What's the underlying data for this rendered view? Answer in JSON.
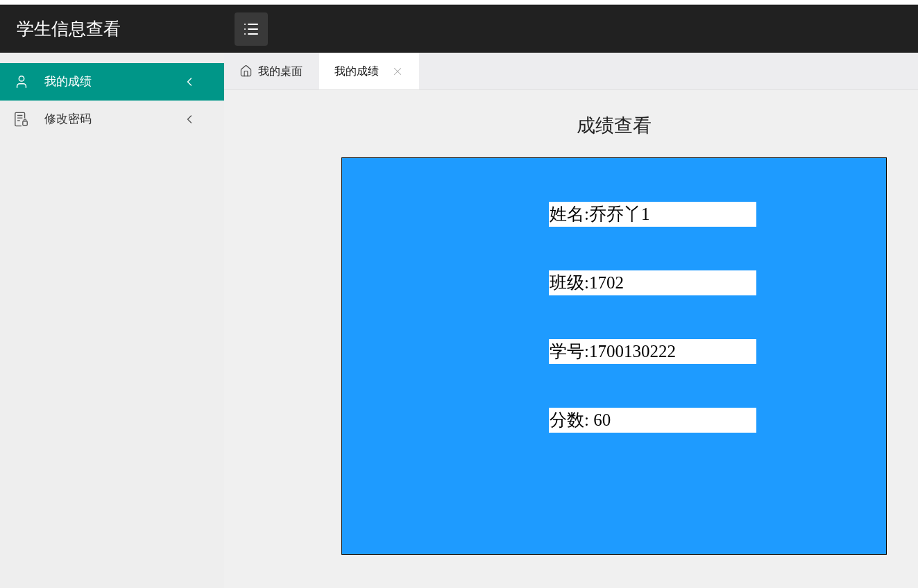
{
  "header": {
    "title": "学生信息查看"
  },
  "sidebar": {
    "items": [
      {
        "label": "我的成绩",
        "selected": true
      },
      {
        "label": "修改密码",
        "selected": false
      }
    ]
  },
  "tabs": [
    {
      "label": "我的桌面",
      "selected": false,
      "kind": "home"
    },
    {
      "label": "我的成绩",
      "selected": true,
      "kind": "closable"
    }
  ],
  "page": {
    "title": "成绩查看",
    "fields": [
      {
        "value": "姓名:乔乔丫1"
      },
      {
        "value": "班级:1702"
      },
      {
        "value": "学号:1700130222"
      },
      {
        "value": "分数: 60"
      }
    ]
  }
}
